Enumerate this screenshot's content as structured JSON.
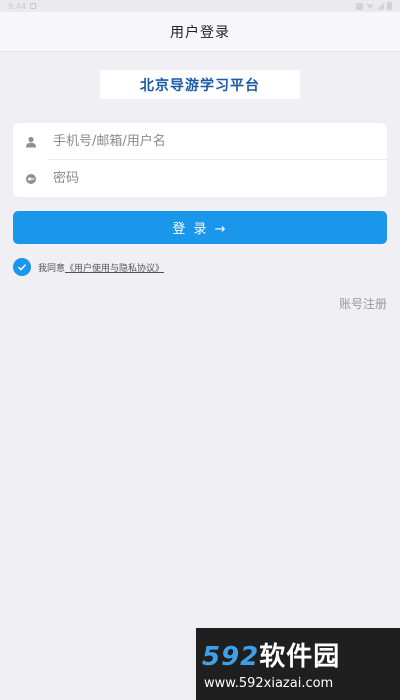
{
  "status_bar": {
    "time": "9:44"
  },
  "header": {
    "title": "用户登录"
  },
  "logo": {
    "text": "北京导游学习平台"
  },
  "form": {
    "username_placeholder": "手机号/邮箱/用户名",
    "username_value": "",
    "password_placeholder": "密码",
    "password_value": ""
  },
  "login_button": {
    "label": "登 录 →"
  },
  "agreement": {
    "prefix": "我同意",
    "link": "《用户使用与隐私协议》",
    "checked": true
  },
  "register": {
    "label": "账号注册"
  },
  "watermark": {
    "logo_number": "592",
    "logo_text": "软件园",
    "url": "www.592xiazai.com"
  },
  "colors": {
    "accent": "#1a96ea",
    "logo_text": "#1b5aa8",
    "background": "#efeff4"
  },
  "icons": [
    "user-icon",
    "lock-icon",
    "check-icon",
    "arrow-right-icon"
  ]
}
